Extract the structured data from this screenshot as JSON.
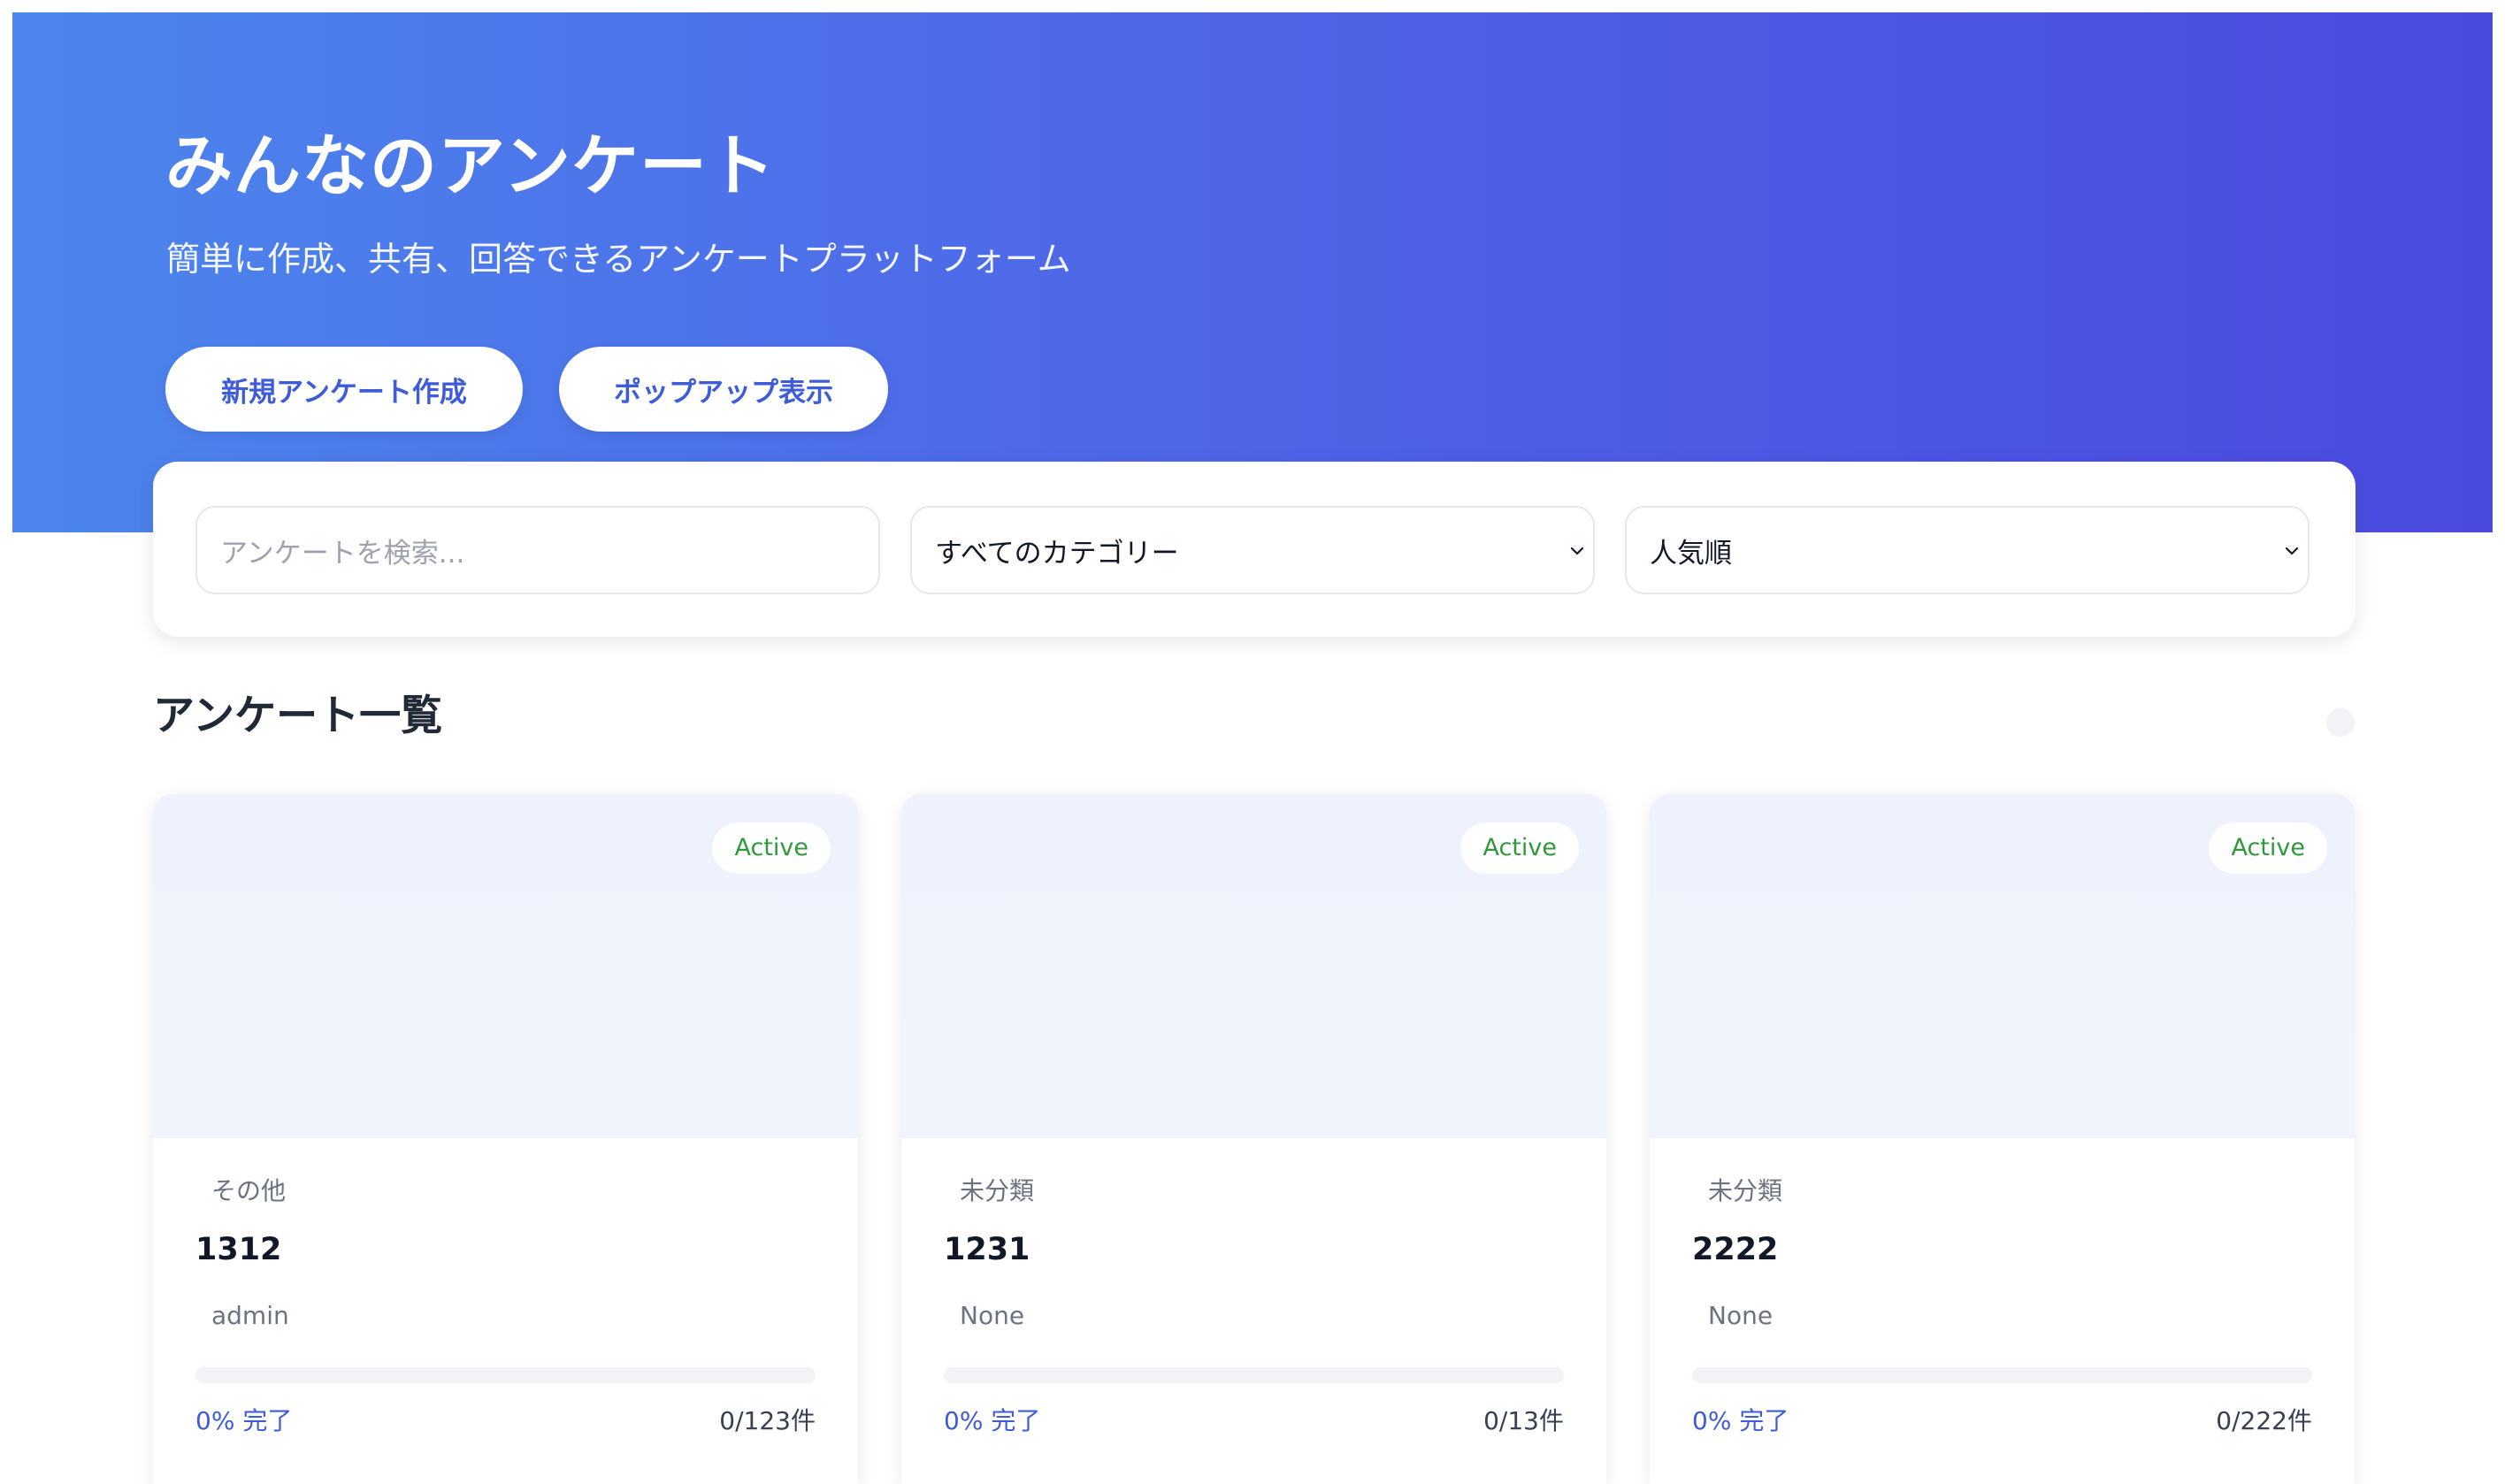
{
  "hero": {
    "title": "みんなのアンケート",
    "subtitle": "簡単に作成、共有、回答できるアンケートプラットフォーム",
    "buttons": {
      "new_survey": "新規アンケート作成",
      "popup": "ポップアップ表示"
    }
  },
  "filters": {
    "search_placeholder": "アンケートを検索...",
    "category_selected": "すべてのカテゴリー",
    "sort_selected": "人気順"
  },
  "survey_list": {
    "title": "アンケート一覧",
    "cards": [
      {
        "status": "Active",
        "category": "その他",
        "title": "1312",
        "author": "admin",
        "progress_percent": 0,
        "progress_text": "0% 完了",
        "count_text": "0/123件"
      },
      {
        "status": "Active",
        "category": "未分類",
        "title": "1231",
        "author": "None",
        "progress_percent": 0,
        "progress_text": "0% 完了",
        "count_text": "0/13件"
      },
      {
        "status": "Active",
        "category": "未分類",
        "title": "2222",
        "author": "None",
        "progress_percent": 0,
        "progress_text": "0% 完了",
        "count_text": "0/222件"
      }
    ]
  },
  "icons": {
    "chevron": "chevron-down-icon"
  },
  "colors": {
    "hero_start": "#4c86ed",
    "hero_end": "#4b4adf",
    "accent": "#3e5bd9",
    "status_active": "#2f9a3a",
    "card_media": "#eef3fd"
  }
}
